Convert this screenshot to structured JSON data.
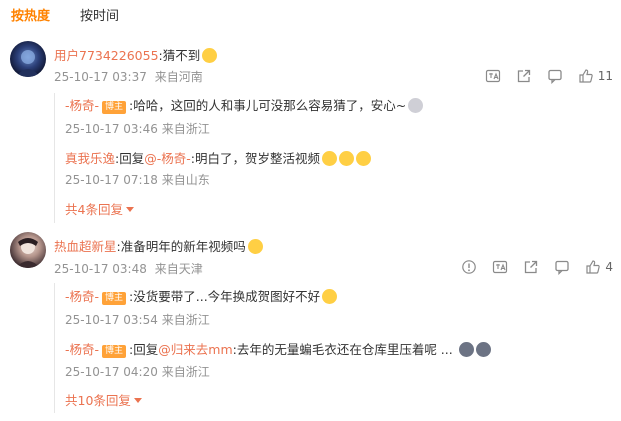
{
  "tabs": [
    {
      "label": "按热度",
      "active": true
    },
    {
      "label": "按时间",
      "active": false
    }
  ],
  "comments": [
    {
      "user": "用户7734226055",
      "text": ":猜不到",
      "time": "25-10-17 03:37",
      "location": "来自河南",
      "likes": "11",
      "replies": [
        {
          "user": "-杨奇-",
          "badge": "博主",
          "text": ":哈哈，这回的人和事儿可没那么容易猜了，安心~",
          "time": "25-10-17 03:46",
          "location": "来自浙江"
        },
        {
          "user": "真我乐逸",
          "text_prefix": ":回复",
          "mention": "@-杨奇-",
          "text": ":明白了，贺岁整活视频",
          "time": "25-10-17 07:18",
          "location": "来自山东"
        }
      ],
      "more": "共4条回复"
    },
    {
      "user": "热血超新星",
      "text": ":准备明年的新年视频吗",
      "time": "25-10-17 03:48",
      "location": "来自天津",
      "likes": "4",
      "replies": [
        {
          "user": "-杨奇-",
          "badge": "博主",
          "text": ":没货要带了...今年换成贺图好不好",
          "time": "25-10-17 03:54",
          "location": "来自浙江"
        },
        {
          "user": "-杨奇-",
          "badge": "博主",
          "text_prefix": ":回复",
          "mention": "@归来去mm",
          "text": ":去年的无量蝙毛衣还在仓库里压着呢 ...",
          "time": "25-10-17 04:20",
          "location": "来自浙江"
        }
      ],
      "more": "共10条回复"
    }
  ],
  "icons": {
    "translate": "translate-icon",
    "share": "share-icon",
    "comment": "comment-icon",
    "like": "thumbs-up-icon",
    "report": "report-icon"
  },
  "colors": {
    "accent": "#ff8200",
    "username": "#eb7350",
    "meta": "#939393",
    "badge": "#ffa238"
  }
}
